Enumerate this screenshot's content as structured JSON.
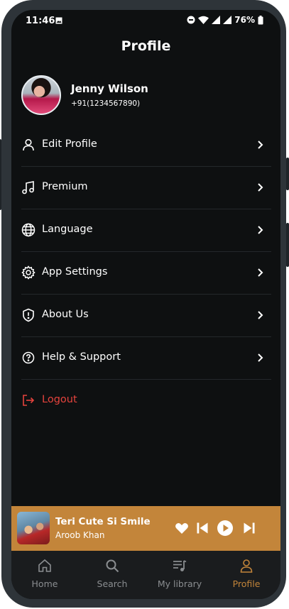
{
  "status_bar": {
    "time": "11:46",
    "battery": "76%"
  },
  "page": {
    "title": "Profile"
  },
  "user": {
    "name": "Jenny Wilson",
    "phone": "+91(1234567890)"
  },
  "menu": {
    "items": [
      {
        "label": "Edit Profile",
        "icon": "user-icon"
      },
      {
        "label": "Premium",
        "icon": "music-note-icon"
      },
      {
        "label": "Language",
        "icon": "globe-icon"
      },
      {
        "label": "App Settings",
        "icon": "gear-icon"
      },
      {
        "label": "About Us",
        "icon": "shield-alert-icon"
      },
      {
        "label": "Help & Support",
        "icon": "question-circle-icon"
      }
    ],
    "logout": {
      "label": "Logout",
      "icon": "logout-icon"
    }
  },
  "now_playing": {
    "title": "Teri Cute Si Smile",
    "artist": "Aroob Khan"
  },
  "bottom_nav": {
    "items": [
      {
        "label": "Home",
        "icon": "home-icon"
      },
      {
        "label": "Search",
        "icon": "search-icon"
      },
      {
        "label": "My library",
        "icon": "library-icon"
      },
      {
        "label": "Profile",
        "icon": "profile-icon",
        "active": true
      }
    ]
  },
  "colors": {
    "background": "#0e1011",
    "accent": "#c3853a",
    "logout": "#e5433d",
    "divider": "#24282b",
    "nav_background": "#1a1c1e",
    "nav_inactive": "#8a8d90"
  }
}
